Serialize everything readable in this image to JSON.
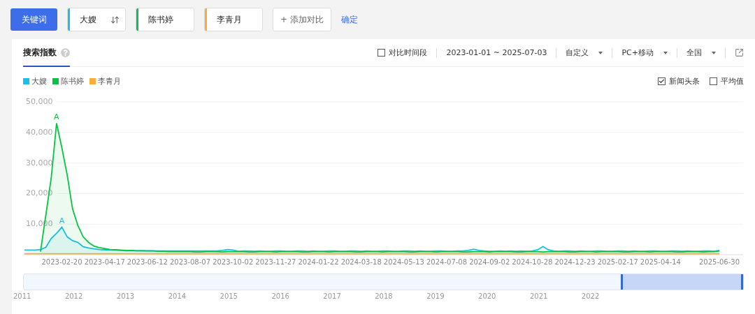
{
  "toolbar": {
    "keyword_button": "关键词",
    "keywords": [
      {
        "name": "大嫂",
        "color": "#1bbfe8",
        "swap": true
      },
      {
        "name": "陈书婷",
        "color": "#0ac244",
        "swap": false
      },
      {
        "name": "李青月",
        "color": "#f7ad3b",
        "swap": false
      }
    ],
    "add_button": "+ 添加对比",
    "confirm_link": "确定"
  },
  "card": {
    "tabs": [
      {
        "label": "搜索指数",
        "selected": true
      }
    ],
    "compare_period": {
      "label": "对比时间段",
      "checked": false
    },
    "date_range": "2023-01-01 ~ 2025-07-03",
    "dropdowns": [
      "自定义",
      "PC+移动",
      "全国"
    ],
    "options": [
      {
        "label": "新闻头条",
        "checked": true
      },
      {
        "label": "平均值",
        "checked": false
      }
    ],
    "chart_data": {
      "type": "area",
      "ylim": [
        0,
        50000
      ],
      "grid": true,
      "yticks": [
        {
          "value": 10000,
          "label": "10,000"
        },
        {
          "value": 20000,
          "label": "20,000"
        },
        {
          "value": 30000,
          "label": "30,000"
        },
        {
          "value": 40000,
          "label": "40,000"
        },
        {
          "value": 50000,
          "label": "50,000"
        }
      ],
      "categories": [
        null,
        null,
        null,
        null,
        null,
        null,
        null,
        "2023-02-20",
        null,
        null,
        null,
        null,
        null,
        null,
        null,
        "2023-04-17",
        null,
        null,
        null,
        null,
        null,
        null,
        null,
        "2023-06-12",
        null,
        null,
        null,
        null,
        null,
        null,
        null,
        "2023-08-07",
        null,
        null,
        null,
        null,
        null,
        null,
        null,
        "2023-10-02",
        null,
        null,
        null,
        null,
        null,
        null,
        null,
        "2023-11-27",
        null,
        null,
        null,
        null,
        null,
        null,
        null,
        "2024-01-22",
        null,
        null,
        null,
        null,
        null,
        null,
        null,
        "2024-03-18",
        null,
        null,
        null,
        null,
        null,
        null,
        null,
        "2024-05-13",
        null,
        null,
        null,
        null,
        null,
        null,
        null,
        "2024-07-08",
        null,
        null,
        null,
        null,
        null,
        null,
        null,
        "2024-09-02",
        null,
        null,
        null,
        null,
        null,
        null,
        null,
        "2024-10-28",
        null,
        null,
        null,
        null,
        null,
        null,
        null,
        "2024-12-23",
        null,
        null,
        null,
        null,
        null,
        null,
        null,
        "2025-02-17",
        null,
        null,
        null,
        null,
        null,
        null,
        null,
        "2025-04-14",
        null,
        null,
        null,
        null,
        null,
        null,
        null,
        null,
        null,
        null,
        "2025-06-30"
      ],
      "series": [
        {
          "name": "大嫂",
          "color": "#1bbfe8",
          "values": [
            1500,
            1500,
            1500,
            1700,
            2400,
            5300,
            7000,
            9000,
            5800,
            4600,
            4000,
            2600,
            2200,
            1900,
            1700,
            1600,
            1600,
            1500,
            1400,
            1300,
            1300,
            1300,
            1300,
            1300,
            1300,
            1200,
            1200,
            1200,
            1200,
            1200,
            1200,
            1200,
            1200,
            1200,
            1200,
            1200,
            1200,
            1400,
            1700,
            1500,
            1100,
            1200,
            1200,
            1100,
            1200,
            1100,
            1100,
            1200,
            1200,
            1100,
            1100,
            1200,
            1200,
            1100,
            1200,
            1100,
            1100,
            1200,
            1200,
            1100,
            1100,
            1200,
            1200,
            1100,
            1200,
            1100,
            1100,
            1200,
            1200,
            1100,
            1100,
            1200,
            1200,
            1100,
            1200,
            1100,
            1100,
            1200,
            1200,
            1100,
            1100,
            1200,
            1200,
            1400,
            1800,
            1400,
            1200,
            1100,
            1100,
            1200,
            1100,
            1200,
            1100,
            1200,
            1100,
            1200,
            1600,
            2700,
            1600,
            1200,
            1100,
            1200,
            1200,
            1100,
            1200,
            1100,
            1100,
            1200,
            1200,
            1100,
            1100,
            1200,
            1200,
            1100,
            1200,
            1100,
            1100,
            1200,
            1200,
            1100,
            1100,
            1200,
            1200,
            1100,
            1200,
            1100,
            1100,
            1200,
            1200,
            1100,
            1400
          ]
        },
        {
          "name": "陈书婷",
          "color": "#0ac244",
          "values": [
            null,
            null,
            null,
            1000,
            13000,
            25000,
            43000,
            35000,
            26000,
            15000,
            9500,
            5800,
            4000,
            2800,
            2300,
            2000,
            1700,
            1600,
            1500,
            1400,
            1400,
            1300,
            1300,
            1200,
            1200,
            1100,
            1100,
            1000,
            1000,
            1000,
            1000,
            1000,
            900,
            900,
            1000,
            1000,
            1000,
            900,
            1000,
            1000,
            1000,
            1000,
            900,
            900,
            1000,
            1000,
            1000,
            900,
            1000,
            1000,
            1000,
            1000,
            900,
            900,
            1000,
            1000,
            1000,
            900,
            1000,
            1000,
            1000,
            1000,
            900,
            900,
            1000,
            1000,
            1000,
            900,
            1000,
            1000,
            1000,
            1000,
            900,
            900,
            1000,
            1000,
            1000,
            900,
            1000,
            1000,
            1000,
            1000,
            900,
            900,
            1000,
            1000,
            1000,
            900,
            1000,
            1000,
            1000,
            1000,
            900,
            900,
            1000,
            1000,
            1000,
            900,
            1000,
            1000,
            1000,
            1000,
            900,
            900,
            1000,
            1000,
            1000,
            900,
            1000,
            1000,
            1000,
            1000,
            900,
            900,
            1000,
            1000,
            1000,
            900,
            1000,
            1000,
            1000,
            1000,
            900,
            900,
            1000,
            1000,
            1000,
            900,
            1000,
            1000,
            1200
          ]
        },
        {
          "name": "李青月",
          "color": "#f7ad3b",
          "values": [
            300,
            300,
            300,
            300,
            300,
            300,
            300,
            300,
            300,
            300,
            300,
            300,
            300,
            300,
            300,
            300,
            300,
            300,
            300,
            300,
            300,
            300,
            300,
            300,
            300,
            300,
            300,
            300,
            300,
            300,
            300,
            300,
            300,
            300,
            300,
            300,
            300,
            300,
            300,
            300,
            300,
            300,
            300,
            300,
            300,
            300,
            300,
            300,
            300,
            300,
            300,
            300,
            300,
            300,
            300,
            300,
            300,
            300,
            300,
            300,
            300,
            300,
            300,
            300,
            300,
            300,
            300,
            300,
            300,
            300,
            300,
            300,
            300,
            300,
            300,
            300,
            300,
            300,
            300,
            300,
            300,
            300,
            300,
            300,
            300,
            300,
            300,
            300,
            300,
            300,
            300,
            300,
            300,
            300,
            300,
            300,
            300,
            300,
            300,
            300,
            300,
            300,
            300,
            300,
            300,
            300,
            300,
            300,
            300,
            300,
            300,
            300,
            300,
            300,
            300,
            300,
            300,
            300,
            300,
            300,
            300,
            300,
            300,
            300,
            300,
            300,
            300,
            300,
            300,
            300,
            300
          ]
        }
      ],
      "annotations": [
        {
          "y": 43000,
          "text": "A"
        },
        {
          "y": 9000,
          "text": "A"
        }
      ]
    }
  },
  "navigator": {
    "years": [
      "2011",
      "2012",
      "2013",
      "2014",
      "2015",
      "2016",
      "2017",
      "2018",
      "2019",
      "2020",
      "2021",
      "2022"
    ]
  }
}
